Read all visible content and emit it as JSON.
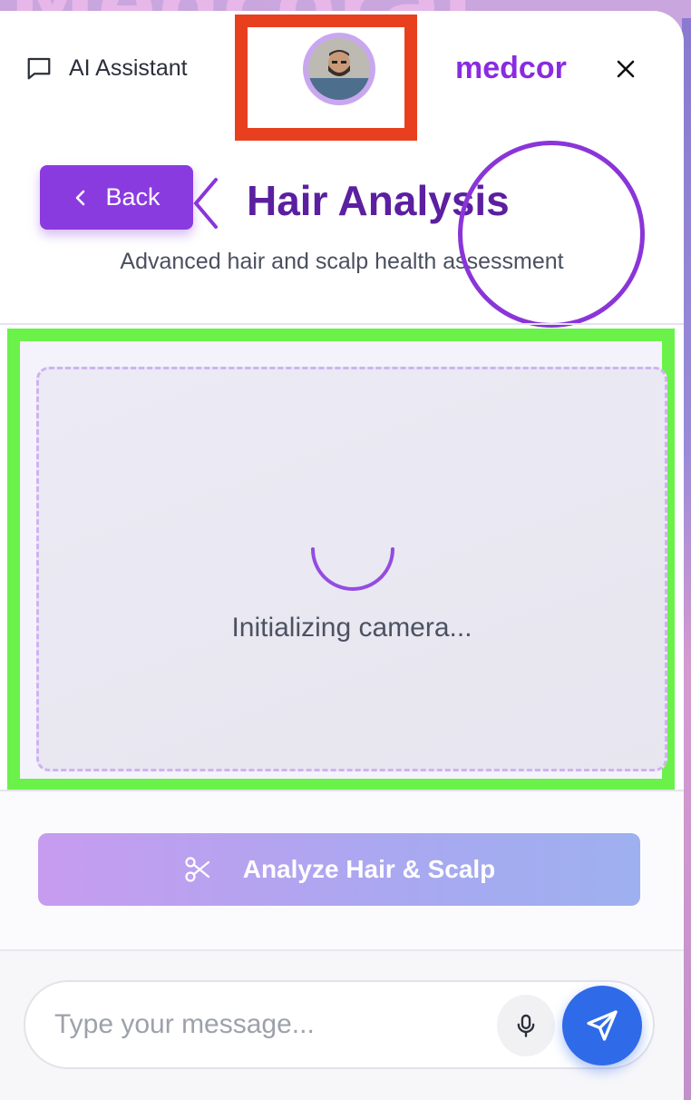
{
  "background": {
    "brand_text": "Medcoral"
  },
  "header": {
    "assistant_label": "AI Assistant",
    "assistant_icon": "chat-bubble-icon",
    "brand": "medcor",
    "close_icon": "close-icon"
  },
  "page": {
    "back_label": "Back",
    "title": "Hair Analysis",
    "subtitle": "Advanced hair and scalp health assessment"
  },
  "camera": {
    "status": "Initializing camera..."
  },
  "actions": {
    "analyze_label": "Analyze Hair & Scalp",
    "analyze_icon": "scissors-icon"
  },
  "composer": {
    "placeholder": "Type your message...",
    "mic_icon": "microphone-icon",
    "send_icon": "send-icon"
  },
  "colors": {
    "accent_purple": "#8a3be0",
    "title_purple": "#5b1fa0",
    "send_blue": "#2f6ae8",
    "highlight_red": "#e8401e",
    "highlight_green": "#6af24a"
  }
}
